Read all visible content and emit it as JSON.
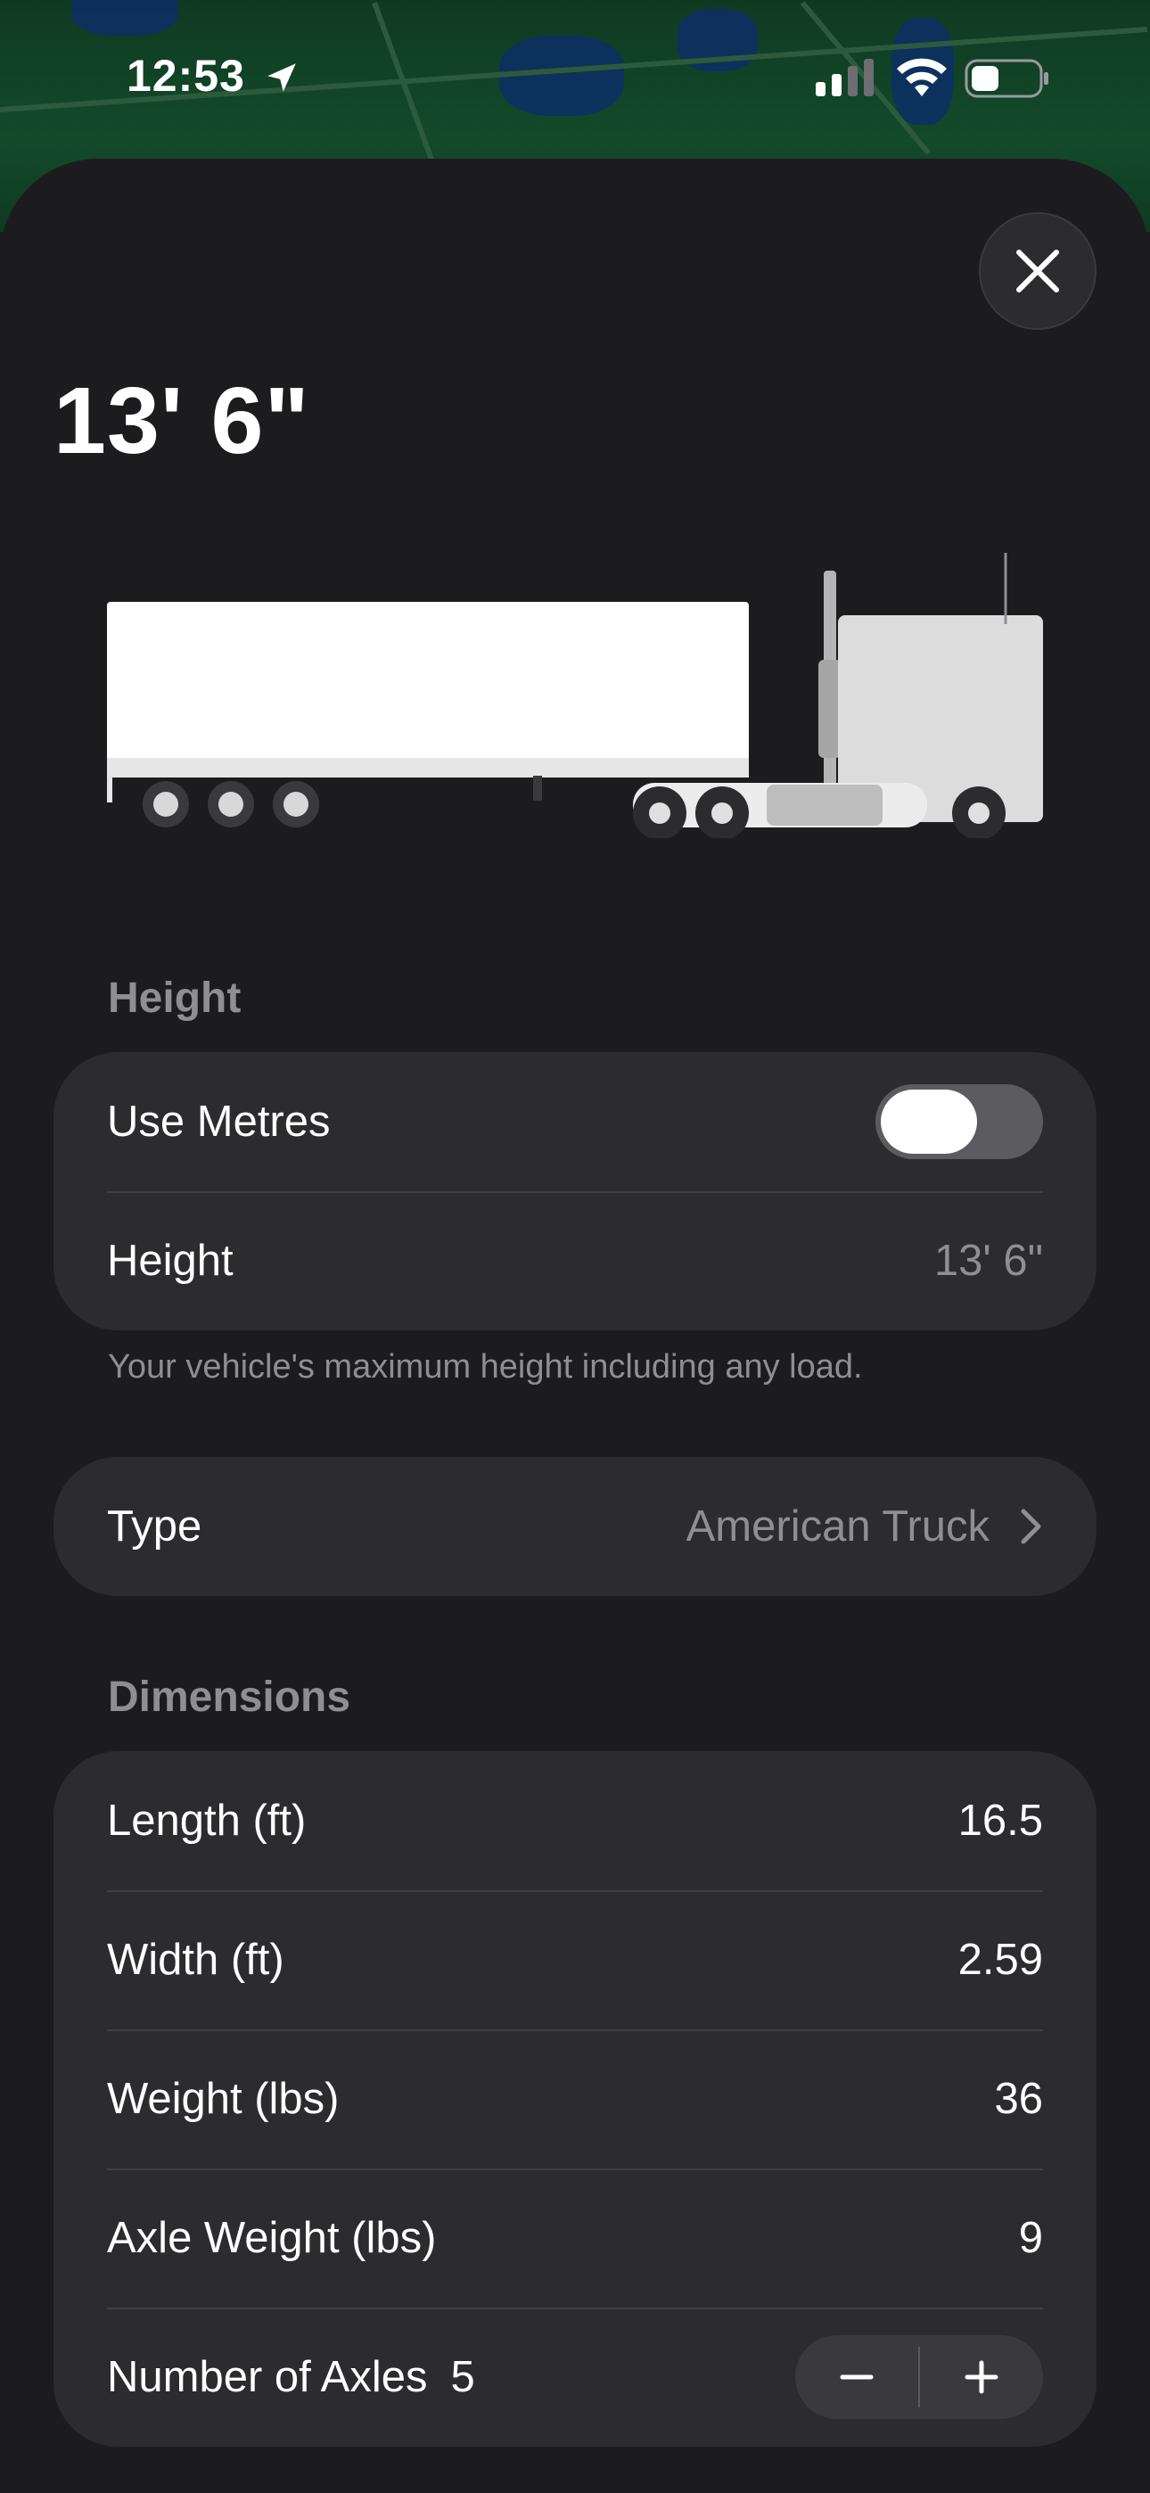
{
  "status_bar": {
    "time": "12:53",
    "icons": [
      "location-arrow-icon",
      "cellular-signal-icon",
      "wifi-icon",
      "battery-icon"
    ]
  },
  "header": {
    "title": "13' 6\"",
    "close_icon": "close-icon"
  },
  "illustration": {
    "name": "American truck illustration"
  },
  "height_section": {
    "label": "Height",
    "use_metres_label": "Use Metres",
    "use_metres_on": false,
    "height_label": "Height",
    "height_value": "13' 6\"",
    "footnote": "Your vehicle's maximum height including any load."
  },
  "type_section": {
    "label": "Type",
    "value": "American Truck"
  },
  "dimensions_section": {
    "label": "Dimensions",
    "rows": [
      {
        "label": "Length (ft)",
        "value": "16.5"
      },
      {
        "label": "Width (ft)",
        "value": "2.59"
      },
      {
        "label": "Weight (lbs)",
        "value": "36"
      },
      {
        "label": "Axle Weight (lbs)",
        "value": "9"
      }
    ],
    "axles_label": "Number of Axles",
    "axles_value": "5",
    "stepper_minus": "−",
    "stepper_plus": "+"
  },
  "colors": {
    "sheet_bg": "#1c1c1e",
    "group_bg": "#2c2c2e",
    "muted_text": "#8e8e93"
  }
}
